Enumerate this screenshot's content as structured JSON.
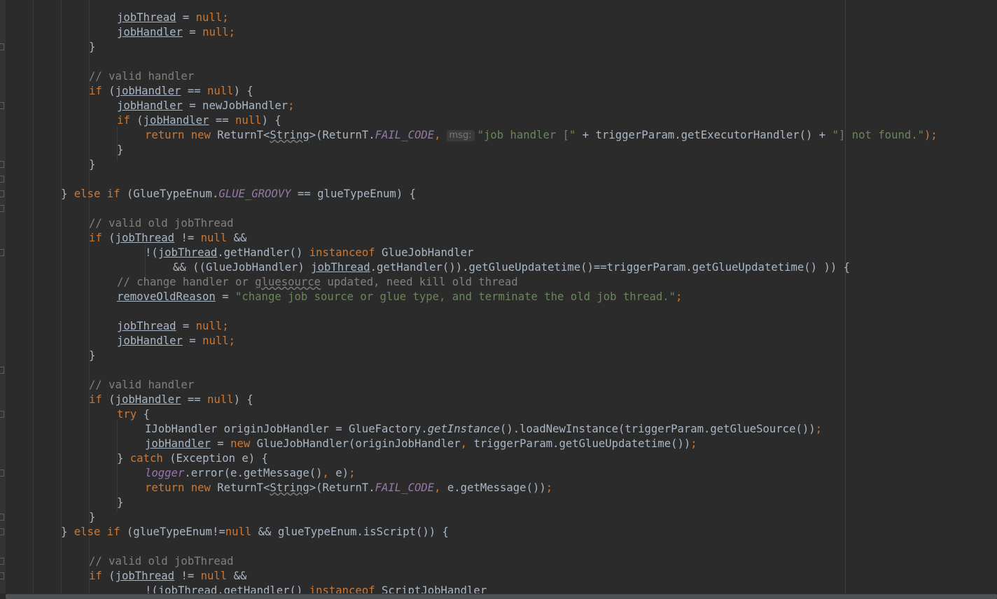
{
  "editor": {
    "lines": [
      {
        "indent": 4,
        "tokens": [
          {
            "t": "jobThread",
            "c": "u"
          },
          {
            "t": " = "
          },
          {
            "t": "null",
            "c": "kw"
          },
          {
            "t": ";",
            "c": "kw"
          }
        ]
      },
      {
        "indent": 4,
        "tokens": [
          {
            "t": "jobHandler",
            "c": "u"
          },
          {
            "t": " = "
          },
          {
            "t": "null",
            "c": "kw"
          },
          {
            "t": ";",
            "c": "kw"
          }
        ]
      },
      {
        "indent": 3,
        "tokens": [
          {
            "t": "}"
          }
        ]
      },
      {
        "indent": 0,
        "tokens": []
      },
      {
        "indent": 3,
        "tokens": [
          {
            "t": "// valid handler",
            "c": "cm"
          }
        ]
      },
      {
        "indent": 3,
        "tokens": [
          {
            "t": "if ",
            "c": "kw"
          },
          {
            "t": "("
          },
          {
            "t": "jobHandler",
            "c": "u"
          },
          {
            "t": " == "
          },
          {
            "t": "null",
            "c": "kw"
          },
          {
            "t": ") {"
          }
        ]
      },
      {
        "indent": 4,
        "tokens": [
          {
            "t": "jobHandler",
            "c": "u"
          },
          {
            "t": " = newJobHandler"
          },
          {
            "t": ";",
            "c": "kw"
          }
        ]
      },
      {
        "indent": 4,
        "tokens": [
          {
            "t": "if ",
            "c": "kw"
          },
          {
            "t": "("
          },
          {
            "t": "jobHandler",
            "c": "u"
          },
          {
            "t": " == "
          },
          {
            "t": "null",
            "c": "kw"
          },
          {
            "t": ") {"
          }
        ]
      },
      {
        "indent": 5,
        "tokens": [
          {
            "t": "return new ",
            "c": "kw"
          },
          {
            "t": "ReturnT<"
          },
          {
            "t": "String",
            "c": "wavy"
          },
          {
            "t": ">(ReturnT."
          },
          {
            "t": "FAIL_CODE",
            "c": "fld"
          },
          {
            "t": ",",
            "c": "kw"
          },
          {
            "t": "msg:",
            "c": "hint"
          },
          {
            "t": "\"job handler [\"",
            "c": "str"
          },
          {
            "t": " + triggerParam.getExecutorHandler() + "
          },
          {
            "t": "\"] not found.\"",
            "c": "str"
          },
          {
            "t": ");",
            "c": "kw"
          }
        ]
      },
      {
        "indent": 4,
        "tokens": [
          {
            "t": "}"
          }
        ]
      },
      {
        "indent": 3,
        "tokens": [
          {
            "t": "}"
          }
        ]
      },
      {
        "indent": 0,
        "tokens": []
      },
      {
        "indent": 2,
        "tokens": [
          {
            "t": "} "
          },
          {
            "t": "else if ",
            "c": "kw"
          },
          {
            "t": "(GlueTypeEnum."
          },
          {
            "t": "GLUE_GROOVY",
            "c": "fld"
          },
          {
            "t": " == glueTypeEnum) {"
          }
        ]
      },
      {
        "indent": 0,
        "tokens": []
      },
      {
        "indent": 3,
        "tokens": [
          {
            "t": "// valid old jobThread",
            "c": "cm"
          }
        ]
      },
      {
        "indent": 3,
        "tokens": [
          {
            "t": "if ",
            "c": "kw"
          },
          {
            "t": "("
          },
          {
            "t": "jobThread",
            "c": "u"
          },
          {
            "t": " != "
          },
          {
            "t": "null ",
            "c": "kw"
          },
          {
            "t": "&&"
          }
        ]
      },
      {
        "indent": 5,
        "tokens": [
          {
            "t": "!("
          },
          {
            "t": "jobThread",
            "c": "u"
          },
          {
            "t": ".getHandler() "
          },
          {
            "t": "instanceof ",
            "c": "kw"
          },
          {
            "t": "GlueJobHandler"
          }
        ]
      },
      {
        "indent": 6,
        "tokens": [
          {
            "t": "&& ((GlueJobHandler) "
          },
          {
            "t": "jobThread",
            "c": "u"
          },
          {
            "t": ".getHandler()).getGlueUpdatetime()==triggerParam.getGlueUpdatetime() )) {"
          }
        ]
      },
      {
        "indent": 4,
        "tokens": [
          {
            "t": "// change handler or ",
            "c": "cm"
          },
          {
            "t": "gluesource",
            "c": "cm wavy"
          },
          {
            "t": " updated, need kill old thread",
            "c": "cm"
          }
        ]
      },
      {
        "indent": 4,
        "tokens": [
          {
            "t": "removeOldReason",
            "c": "u"
          },
          {
            "t": " = "
          },
          {
            "t": "\"change job source or glue type, and terminate the old job thread.\"",
            "c": "str"
          },
          {
            "t": ";",
            "c": "kw"
          }
        ]
      },
      {
        "indent": 0,
        "tokens": []
      },
      {
        "indent": 4,
        "tokens": [
          {
            "t": "jobThread",
            "c": "u"
          },
          {
            "t": " = "
          },
          {
            "t": "null",
            "c": "kw"
          },
          {
            "t": ";",
            "c": "kw"
          }
        ]
      },
      {
        "indent": 4,
        "tokens": [
          {
            "t": "jobHandler",
            "c": "u"
          },
          {
            "t": " = "
          },
          {
            "t": "null",
            "c": "kw"
          },
          {
            "t": ";",
            "c": "kw"
          }
        ]
      },
      {
        "indent": 3,
        "tokens": [
          {
            "t": "}"
          }
        ]
      },
      {
        "indent": 0,
        "tokens": []
      },
      {
        "indent": 3,
        "tokens": [
          {
            "t": "// valid handler",
            "c": "cm"
          }
        ]
      },
      {
        "indent": 3,
        "tokens": [
          {
            "t": "if ",
            "c": "kw"
          },
          {
            "t": "("
          },
          {
            "t": "jobHandler",
            "c": "u"
          },
          {
            "t": " == "
          },
          {
            "t": "null",
            "c": "kw"
          },
          {
            "t": ") {"
          }
        ]
      },
      {
        "indent": 4,
        "tokens": [
          {
            "t": "try ",
            "c": "kw"
          },
          {
            "t": "{"
          }
        ]
      },
      {
        "indent": 5,
        "tokens": [
          {
            "t": "IJobHandler originJobHandler = GlueFactory."
          },
          {
            "t": "getInstance",
            "c": "ital"
          },
          {
            "t": "().loadNewInstance(triggerParam.getGlueSource())"
          },
          {
            "t": ";",
            "c": "kw"
          }
        ]
      },
      {
        "indent": 5,
        "tokens": [
          {
            "t": "jobHandler",
            "c": "u"
          },
          {
            "t": " = "
          },
          {
            "t": "new ",
            "c": "kw"
          },
          {
            "t": "GlueJobHandler(originJobHandler"
          },
          {
            "t": ", ",
            "c": "kw"
          },
          {
            "t": "triggerParam.getGlueUpdatetime())"
          },
          {
            "t": ";",
            "c": "kw"
          }
        ]
      },
      {
        "indent": 4,
        "tokens": [
          {
            "t": "} "
          },
          {
            "t": "catch ",
            "c": "kw"
          },
          {
            "t": "(Exception e) {"
          }
        ]
      },
      {
        "indent": 5,
        "tokens": [
          {
            "t": "logger",
            "c": "fld"
          },
          {
            "t": ".error(e.getMessage()"
          },
          {
            "t": ", ",
            "c": "kw"
          },
          {
            "t": "e)"
          },
          {
            "t": ";",
            "c": "kw"
          }
        ]
      },
      {
        "indent": 5,
        "tokens": [
          {
            "t": "return new ",
            "c": "kw"
          },
          {
            "t": "ReturnT<"
          },
          {
            "t": "String",
            "c": "wavy"
          },
          {
            "t": ">(ReturnT."
          },
          {
            "t": "FAIL_CODE",
            "c": "fld"
          },
          {
            "t": ", ",
            "c": "kw"
          },
          {
            "t": "e.getMessage())"
          },
          {
            "t": ";",
            "c": "kw"
          }
        ]
      },
      {
        "indent": 4,
        "tokens": [
          {
            "t": "}"
          }
        ]
      },
      {
        "indent": 3,
        "tokens": [
          {
            "t": "}"
          }
        ]
      },
      {
        "indent": 2,
        "tokens": [
          {
            "t": "} "
          },
          {
            "t": "else if ",
            "c": "kw"
          },
          {
            "t": "(glueTypeEnum!="
          },
          {
            "t": "null ",
            "c": "kw"
          },
          {
            "t": "&& glueTypeEnum.isScript()) {"
          }
        ]
      },
      {
        "indent": 0,
        "tokens": []
      },
      {
        "indent": 3,
        "tokens": [
          {
            "t": "// valid old jobThread",
            "c": "cm"
          }
        ]
      },
      {
        "indent": 3,
        "tokens": [
          {
            "t": "if ",
            "c": "kw"
          },
          {
            "t": "("
          },
          {
            "t": "jobThread",
            "c": "u"
          },
          {
            "t": " != "
          },
          {
            "t": "null ",
            "c": "kw"
          },
          {
            "t": "&&"
          }
        ]
      },
      {
        "indent": 5,
        "tokens": [
          {
            "t": "!("
          },
          {
            "t": "jobThread",
            "c": "u"
          },
          {
            "t": ".getHandler() "
          },
          {
            "t": "instanceof ",
            "c": "kw"
          },
          {
            "t": "ScriptJobHandler"
          }
        ]
      }
    ]
  }
}
